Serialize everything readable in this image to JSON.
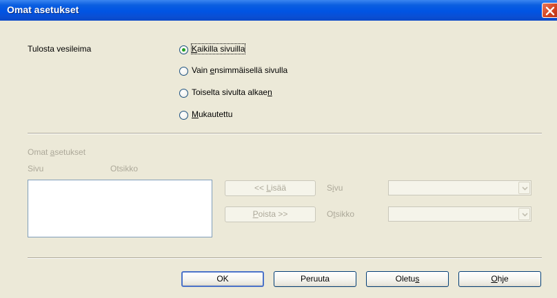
{
  "window": {
    "title": "Omat asetukset",
    "close_icon": "close-icon",
    "close_color": "#d2421f"
  },
  "watermark": {
    "label": "Tulosta vesileima",
    "options": [
      {
        "pre": "",
        "ul": "K",
        "post": "aikilla sivuilla",
        "checked": true
      },
      {
        "pre": "Vain ",
        "ul": "e",
        "post": "nsimmäisellä sivulla",
        "checked": false
      },
      {
        "pre": "Toiselta sivulta alkae",
        "ul": "n",
        "post": "",
        "checked": false
      },
      {
        "pre": "",
        "ul": "M",
        "post": "ukautettu",
        "checked": false
      }
    ]
  },
  "custom": {
    "group_label": {
      "pre": "Omat ",
      "ul": "a",
      "post": "setukset"
    },
    "col_page": "Sivu",
    "col_title": "Otsikko",
    "add_button": {
      "pre": "<< ",
      "ul": "L",
      "post": "isää"
    },
    "remove_button": {
      "pre": "",
      "ul": "P",
      "post": "oista >>"
    },
    "page_label": {
      "pre": "S",
      "ul": "i",
      "post": "vu"
    },
    "title_label": {
      "pre": "O",
      "ul": "t",
      "post": "sikko"
    },
    "page_value": "",
    "title_value": ""
  },
  "footer": {
    "ok": {
      "pre": "OK",
      "ul": "",
      "post": ""
    },
    "cancel": {
      "pre": "Peruuta",
      "ul": "",
      "post": ""
    },
    "default": {
      "pre": "Oletu",
      "ul": "s",
      "post": ""
    },
    "help": {
      "pre": "",
      "ul": "O",
      "post": "hje"
    }
  }
}
